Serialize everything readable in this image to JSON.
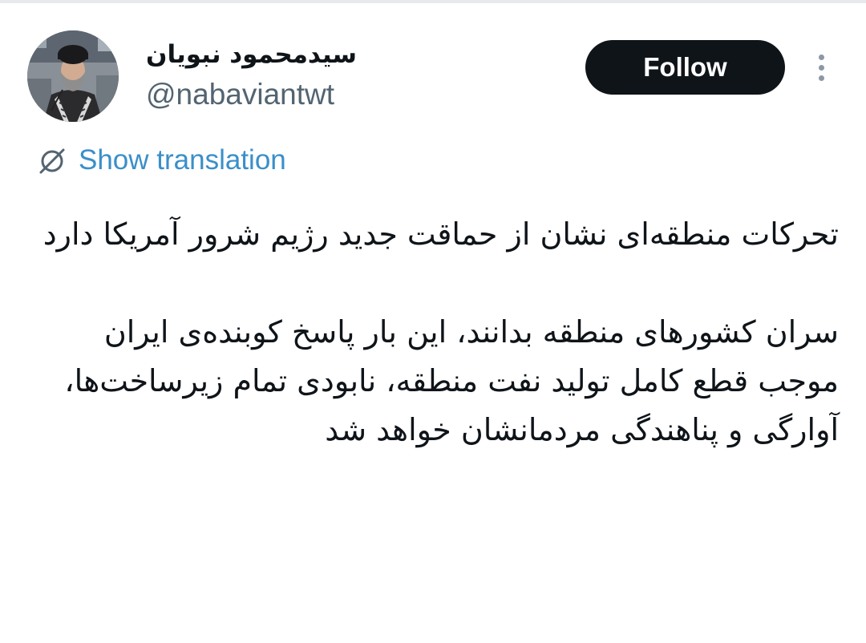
{
  "author": {
    "display_name": "سیدمحمود نبویان",
    "handle": "@nabaviantwt"
  },
  "actions": {
    "follow_label": "Follow",
    "more_icon": "more-vertical-icon"
  },
  "translation": {
    "label": "Show translation",
    "icon": "translate-icon"
  },
  "tweet": {
    "text": "تحرکات منطقه‌ای نشان از حماقت جدید رژیم شرور آمریکا دارد\n\nسران کشورهای منطقه بدانند، این بار پاسخ کوبنده‌ی ایران موجب قطع کامل تولید نفت منطقه، نابودی تمام زیرساخت‌ها،  آوارگی و پناهندگی مردمانشان خواهد شد"
  },
  "colors": {
    "link": "#3a8fc9",
    "button_bg": "#0f1419",
    "secondary_text": "#536471"
  }
}
